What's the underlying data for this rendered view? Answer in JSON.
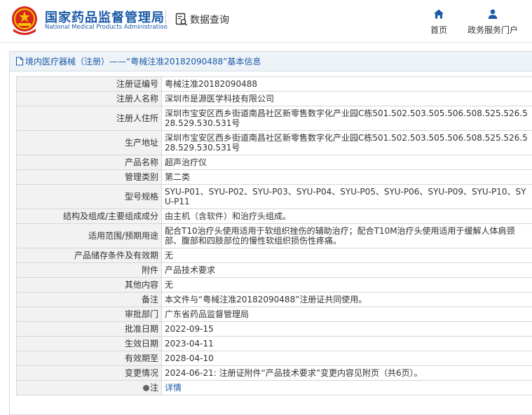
{
  "header": {
    "brand_cn": "国家药品监督管理局",
    "brand_en": "National Medical Products Administration",
    "query_label": "数据查询",
    "nav": [
      {
        "label": "首页",
        "icon": "home-icon"
      },
      {
        "label": "政务服务门户",
        "icon": "user-icon"
      }
    ]
  },
  "panel": {
    "title": "境内医疗器械（注册）——“粤械注准20182090488”基本信息"
  },
  "rows": [
    {
      "label": "注册证编号",
      "value": "粤械注准20182090488"
    },
    {
      "label": "注册人名称",
      "value": "深圳市是源医学科技有限公司"
    },
    {
      "label": "注册人住所",
      "value": "深圳市宝安区西乡街道南昌社区新零售数字化产业园C栋501.502.503.505.506.508.525.526.528.529.530.531号"
    },
    {
      "label": "生产地址",
      "value": "深圳市宝安区西乡街道南昌社区新零售数字化产业园C栋501.502.503.505.506.508.525.526.528.529.530.531号"
    },
    {
      "label": "产品名称",
      "value": "超声治疗仪"
    },
    {
      "label": "管理类别",
      "value": "第二类"
    },
    {
      "label": "型号规格",
      "value": "SYU-P01、SYU-P02、SYU-P03、SYU-P04、SYU-P05、SYU-P06、SYU-P09、SYU-P10、SYU-P11"
    },
    {
      "label": "结构及组成/主要组成成分",
      "value": "由主机（含软件）和治疗头组成。"
    },
    {
      "label": "适用范围/预期用途",
      "value": "配合T10治疗头使用适用于软组织挫伤的辅助治疗；配合T10M治疗头使用适用于缓解人体肩颈部、腹部和四肢部位的慢性软组织损伤性疼痛。"
    },
    {
      "label": "产品储存条件及有效期",
      "value": "无"
    },
    {
      "label": "附件",
      "value": "产品技术要求"
    },
    {
      "label": "其他内容",
      "value": "无"
    },
    {
      "label": "备注",
      "value": "本文件与“粤械注准20182090488”注册证共同使用。"
    },
    {
      "label": "审批部门",
      "value": "广东省药品监督管理局"
    },
    {
      "label": "批准日期",
      "value": "2022-09-15"
    },
    {
      "label": "生效日期",
      "value": "2023-04-11"
    },
    {
      "label": "有效期至",
      "value": "2028-04-10"
    },
    {
      "label": "变更情况",
      "value": "2024-06-21: 注册证附件“产品技术要求”变更内容见附页（共6页）。"
    }
  ],
  "note_row": {
    "label": "注",
    "link": "详情"
  },
  "colors": {
    "brand_blue": "#1a5aa8",
    "label_bg": "#f2f2f2",
    "title_bg": "#eef3f8"
  }
}
